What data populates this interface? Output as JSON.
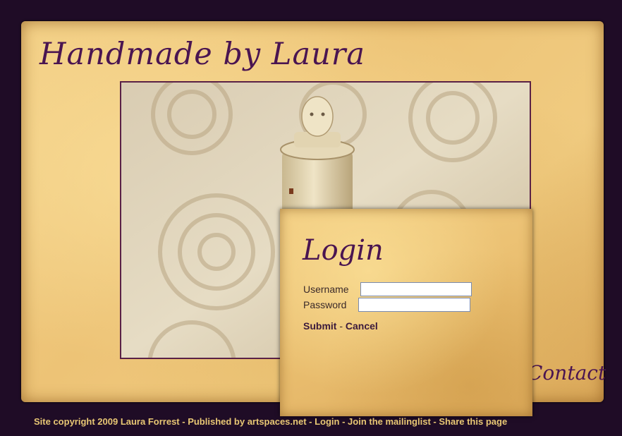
{
  "site": {
    "title": "Handmade by Laura"
  },
  "nav": {
    "contact_label": "Contact"
  },
  "login": {
    "title": "Login",
    "username_label": "Username",
    "username_value": "",
    "password_label": "Password",
    "password_value": "",
    "submit_label": "Submit",
    "separator": " - ",
    "cancel_label": "Cancel"
  },
  "footer": {
    "copyright": "Site copyright 2009 Laura Forrest",
    "sep1": " - ",
    "published_by": "Published by artspaces.net",
    "sep2": " - ",
    "login_link": "Login",
    "sep3": " - ",
    "mailinglist_link": "Join the mailinglist",
    "sep4": " - ",
    "share_link": "Share this page"
  },
  "colors": {
    "background": "#1f0c26",
    "paper": "#f0cb80",
    "accent_text": "#4a1551",
    "footer_text": "#e8c774"
  }
}
